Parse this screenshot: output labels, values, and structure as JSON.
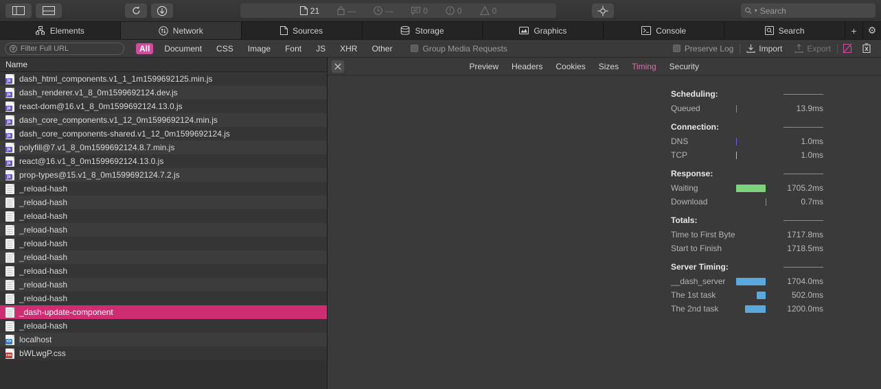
{
  "toolbar": {
    "left_buttons": [
      {
        "name": "toggle-sidebar-left",
        "icon": "panel-left-icon"
      },
      {
        "name": "toggle-sidebar-bottom",
        "icon": "panel-bottom-icon"
      }
    ],
    "mid_buttons": [
      {
        "name": "reload-button",
        "icon": "reload-icon",
        "glyph": "↻"
      },
      {
        "name": "download-button",
        "icon": "download-circle-icon",
        "glyph": "↓"
      }
    ],
    "counters": [
      {
        "name": "resources-count",
        "icon": "document-icon",
        "value": "21",
        "style": "bright"
      },
      {
        "name": "size-count",
        "icon": "bag-icon",
        "value": "—",
        "style": "dim"
      },
      {
        "name": "time-count",
        "icon": "clock-icon",
        "value": "—",
        "style": "dim"
      },
      {
        "name": "logs-count",
        "icon": "message-icon",
        "value": "0",
        "style": "dim"
      },
      {
        "name": "errors-count",
        "icon": "error-icon",
        "value": "0",
        "style": "dim"
      },
      {
        "name": "warnings-count",
        "icon": "warning-icon",
        "value": "0",
        "style": "dim"
      }
    ],
    "inspect_button": {
      "name": "element-selector-button",
      "icon": "crosshair-icon"
    },
    "search": {
      "placeholder": "Search",
      "value": "",
      "icon": "search-icon"
    }
  },
  "tabs": [
    {
      "label": "Elements",
      "icon": "elements-icon",
      "active": false
    },
    {
      "label": "Network",
      "icon": "network-icon",
      "active": true
    },
    {
      "label": "Sources",
      "icon": "sources-icon",
      "active": false
    },
    {
      "label": "Storage",
      "icon": "storage-icon",
      "active": false
    },
    {
      "label": "Graphics",
      "icon": "graphics-icon",
      "active": false
    },
    {
      "label": "Console",
      "icon": "console-icon",
      "active": false
    },
    {
      "label": "Search",
      "icon": "search-tab-icon",
      "active": false
    }
  ],
  "tab_extras": [
    {
      "name": "add-tab-button",
      "glyph": "+"
    },
    {
      "name": "settings-button",
      "glyph": "⚙"
    }
  ],
  "filterbar": {
    "filter_input": {
      "placeholder": "Filter Full URL",
      "value": ""
    },
    "types": [
      {
        "label": "All",
        "selected": true
      },
      {
        "label": "Document",
        "selected": false
      },
      {
        "label": "CSS",
        "selected": false
      },
      {
        "label": "Image",
        "selected": false
      },
      {
        "label": "Font",
        "selected": false
      },
      {
        "label": "JS",
        "selected": false
      },
      {
        "label": "XHR",
        "selected": false
      },
      {
        "label": "Other",
        "selected": false
      }
    ],
    "group_media": {
      "label": "Group Media Requests",
      "checked": false
    },
    "preserve_log": {
      "label": "Preserve Log",
      "checked": false
    },
    "import_label": "Import",
    "export_label": "Export",
    "disable_cache": {
      "name": "disable-cache-icon"
    },
    "clear_network": {
      "name": "trash-icon"
    },
    "accent_pink": "#d44a9e"
  },
  "list": {
    "header": "Name",
    "rows": [
      {
        "label": "dash_html_components.v1_1_1m1599692125.min.js",
        "type": "js",
        "selected": false
      },
      {
        "label": "dash_renderer.v1_8_0m1599692124.dev.js",
        "type": "js",
        "selected": false
      },
      {
        "label": "react-dom@16.v1_8_0m1599692124.13.0.js",
        "type": "js",
        "selected": false
      },
      {
        "label": "dash_core_components.v1_12_0m1599692124.min.js",
        "type": "js",
        "selected": false
      },
      {
        "label": "dash_core_components-shared.v1_12_0m1599692124.js",
        "type": "js",
        "selected": false
      },
      {
        "label": "polyfill@7.v1_8_0m1599692124.8.7.min.js",
        "type": "js",
        "selected": false
      },
      {
        "label": "react@16.v1_8_0m1599692124.13.0.js",
        "type": "js",
        "selected": false
      },
      {
        "label": "prop-types@15.v1_8_0m1599692124.7.2.js",
        "type": "js",
        "selected": false
      },
      {
        "label": "_reload-hash",
        "type": "doc",
        "selected": false
      },
      {
        "label": "_reload-hash",
        "type": "doc",
        "selected": false
      },
      {
        "label": "_reload-hash",
        "type": "doc",
        "selected": false
      },
      {
        "label": "_reload-hash",
        "type": "doc",
        "selected": false
      },
      {
        "label": "_reload-hash",
        "type": "doc",
        "selected": false
      },
      {
        "label": "_reload-hash",
        "type": "doc",
        "selected": false
      },
      {
        "label": "_reload-hash",
        "type": "doc",
        "selected": false
      },
      {
        "label": "_reload-hash",
        "type": "doc",
        "selected": false
      },
      {
        "label": "_reload-hash",
        "type": "doc",
        "selected": false
      },
      {
        "label": "_dash-update-component",
        "type": "doc",
        "selected": true
      },
      {
        "label": "_reload-hash",
        "type": "doc",
        "selected": false
      },
      {
        "label": "localhost",
        "type": "html",
        "selected": false
      },
      {
        "label": "bWLwgP.css",
        "type": "css",
        "selected": false
      }
    ]
  },
  "detail": {
    "close_icon": "close-icon",
    "tabs": [
      {
        "label": "Preview",
        "active": false
      },
      {
        "label": "Headers",
        "active": false
      },
      {
        "label": "Cookies",
        "active": false
      },
      {
        "label": "Sizes",
        "active": false
      },
      {
        "label": "Timing",
        "active": true
      },
      {
        "label": "Security",
        "active": false
      }
    ]
  },
  "chart_data": {
    "type": "bar",
    "title": "Network Request Timing Waterfall",
    "xlabel": "",
    "ylabel": "",
    "axis_total_ms": 1718.5,
    "colors": {
      "queued": "#8c8c8c",
      "dns": "#6d5fd6",
      "tcp": "#bdbdbd",
      "waiting": "#7bd47b",
      "download": "#4fa3e3",
      "server": "#59a9dd"
    },
    "sections": [
      {
        "name": "Scheduling",
        "heading": "Scheduling:",
        "rows": [
          {
            "label": "Queued",
            "value": "13.9ms",
            "ms": 13.9,
            "start_pct": 0.0,
            "width_pct": 0.55,
            "color_key": "queued"
          }
        ]
      },
      {
        "name": "Connection",
        "heading": "Connection:",
        "rows": [
          {
            "label": "DNS",
            "value": "1.0ms",
            "ms": 1.0,
            "start_pct": 0.75,
            "width_pct": 0.25,
            "color_key": "dns"
          },
          {
            "label": "TCP",
            "value": "1.0ms",
            "ms": 1.0,
            "start_pct": 0.75,
            "width_pct": 0.25,
            "color_key": "tcp"
          }
        ]
      },
      {
        "name": "Response",
        "heading": "Response:",
        "rows": [
          {
            "label": "Waiting",
            "value": "1705.2ms",
            "ms": 1705.2,
            "start_pct": 0.8,
            "width_pct": 99.2,
            "color_key": "waiting"
          },
          {
            "label": "Download",
            "value": "0.7ms",
            "ms": 0.7,
            "start_pct": 99.75,
            "width_pct": 0.25,
            "color_key": "download"
          }
        ]
      },
      {
        "name": "Totals",
        "heading": "Totals:",
        "rows": [
          {
            "label": "Time to First Byte",
            "value": "1717.8ms",
            "ms": 1717.8,
            "bar": false
          },
          {
            "label": "Start to Finish",
            "value": "1718.5ms",
            "ms": 1718.5,
            "bar": false
          }
        ]
      },
      {
        "name": "Server Timing",
        "heading": "Server Timing:",
        "rows": [
          {
            "label": "__dash_server",
            "value": "1704.0ms",
            "ms": 1704.0,
            "start_pct": 0.0,
            "width_pct": 100.0,
            "color_key": "server"
          },
          {
            "label": "The 1st task",
            "value": "502.0ms",
            "ms": 502.0,
            "start_pct": 70.5,
            "width_pct": 29.5,
            "color_key": "server"
          },
          {
            "label": "The 2nd task",
            "value": "1200.0ms",
            "ms": 1200.0,
            "start_pct": 29.5,
            "width_pct": 70.5,
            "color_key": "server"
          }
        ]
      }
    ]
  }
}
